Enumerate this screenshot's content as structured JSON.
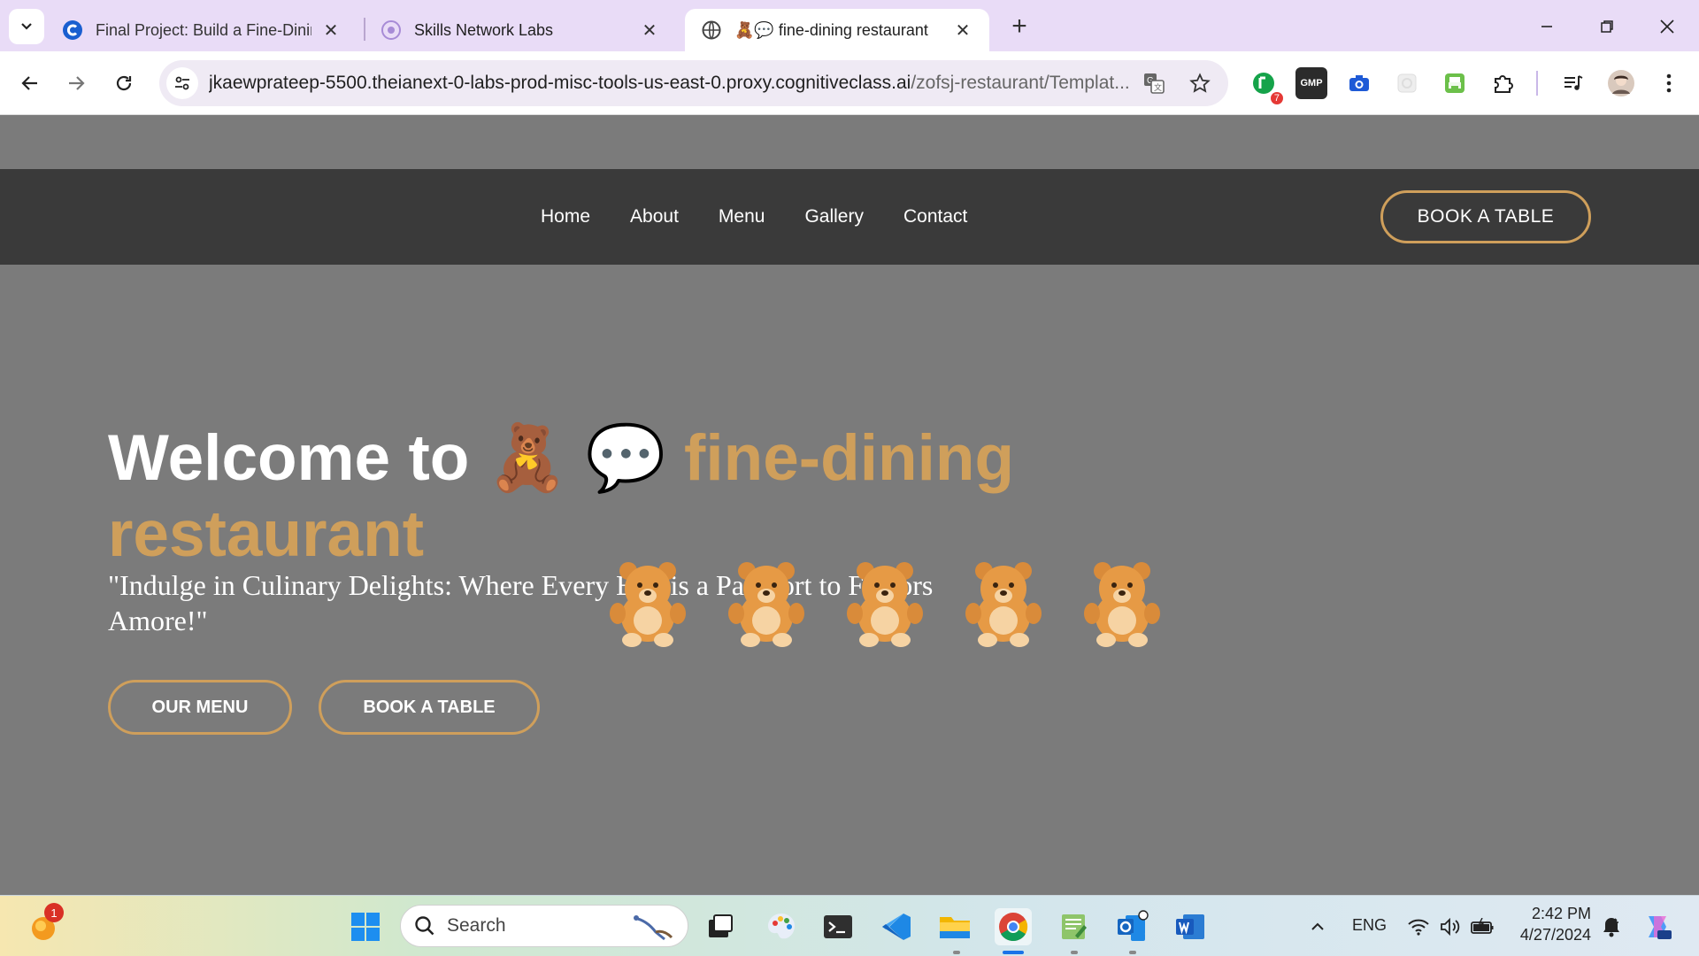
{
  "browser": {
    "tabs": [
      {
        "title": "Final Project: Build a Fine-Dining",
        "active": false
      },
      {
        "title": "Skills Network Labs",
        "active": false
      },
      {
        "title": "🧸💬 fine-dining restaurant",
        "active": true
      }
    ],
    "url_host": "jkaewprateep-5500.theianext-0-labs-prod-misc-tools-us-east-0.proxy.cognitiveclass.ai",
    "url_path": "/zofsj-restaurant/Templat...",
    "extension_badge": "7",
    "gmp_label": "GMP"
  },
  "site": {
    "nav": [
      "Home",
      "About",
      "Menu",
      "Gallery",
      "Contact"
    ],
    "book_button": "BOOK A TABLE",
    "hero": {
      "title_prefix": "Welcome to",
      "title_emoji": "🧸 💬",
      "title_accent_1": "fine-dining",
      "title_accent_2": "restaurant",
      "quote": "\"Indulge in Culinary Delights: Where Every Bite is a Passport to Flavors Amore!\"",
      "bear_emoji": "🧸",
      "menu_button": "OUR MENU",
      "book_button": "BOOK A TABLE"
    }
  },
  "taskbar": {
    "search_placeholder": "Search",
    "notification_count": "1",
    "language": "ENG",
    "time": "2:42 PM",
    "date": "4/27/2024"
  },
  "colors": {
    "accent": "#cf9f5b",
    "nav_bg": "#3a3a3a",
    "page_bg": "#7b7b7b",
    "tabstrip_bg": "#e9dcf7"
  }
}
